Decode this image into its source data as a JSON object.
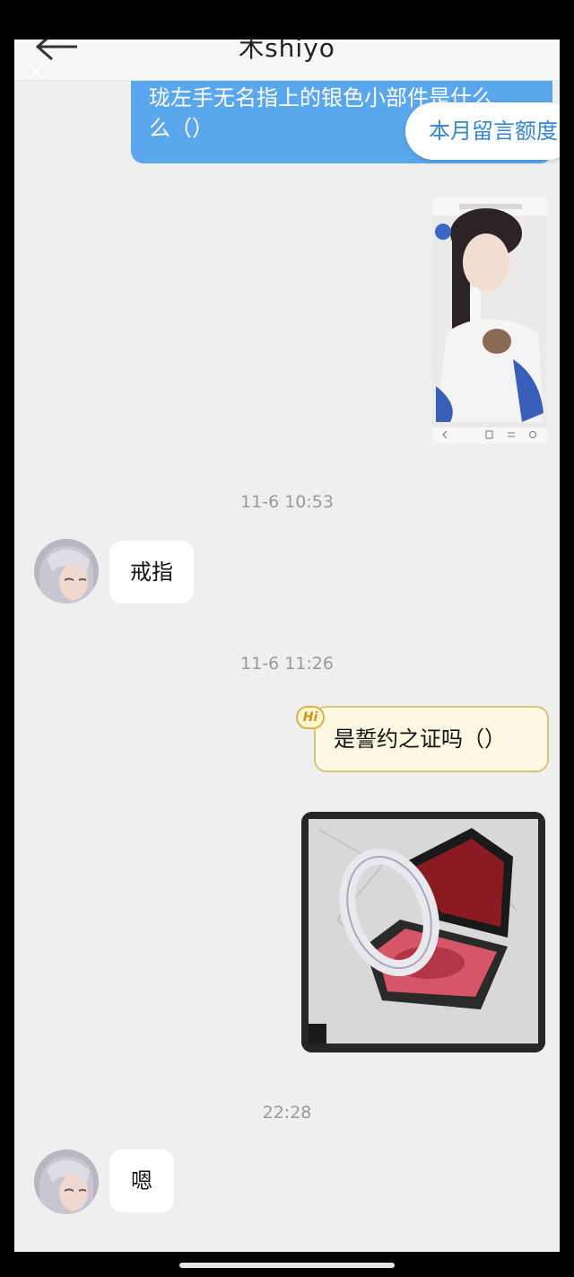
{
  "header": {
    "title": "木shiyo"
  },
  "messages": {
    "outgoing_question": {
      "line1": "珑左手无名指上的银色小部件是什么",
      "line2": "么（）"
    },
    "quota_popup": "本月留言额度",
    "time_1": "11-6 10:53",
    "reply_1": "戒指",
    "time_2": "11-6 11:26",
    "hi_badge": "Hi",
    "outgoing_2": "是誓约之证吗（）",
    "time_3": "22:28",
    "reply_2": "嗯"
  },
  "colors": {
    "outgoing_bubble": "#5aa7ee",
    "chat_background": "#efefef",
    "special_bubble": "#fdf8e2"
  }
}
